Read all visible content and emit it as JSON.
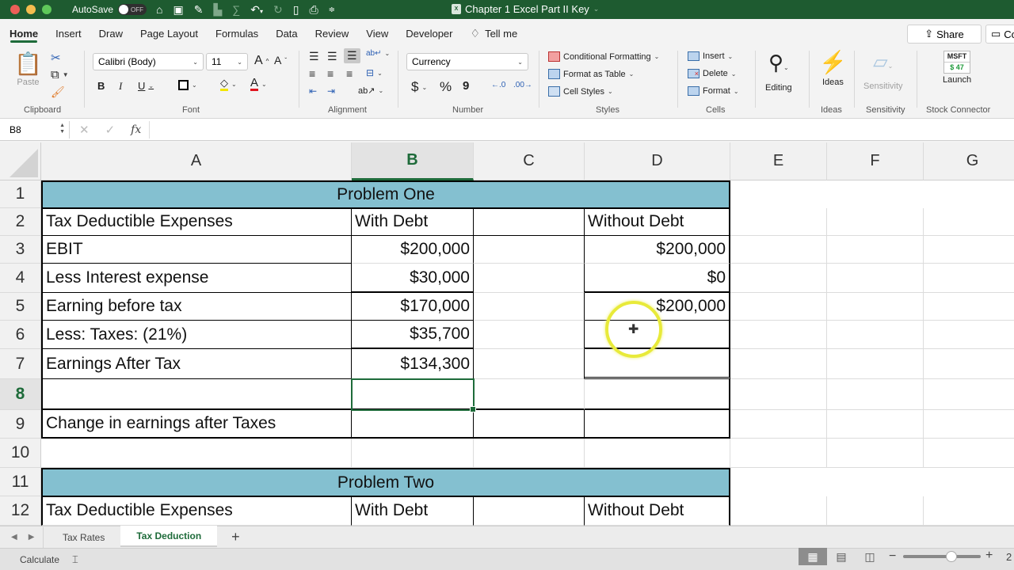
{
  "titlebar": {
    "autosave_label": "AutoSave",
    "autosave_state": "OFF",
    "document_title": "Chapter 1 Excel Part II  Key",
    "traffic_colors": [
      "#ec5f58",
      "#f4bd4f",
      "#5fc85a"
    ],
    "qat_icons": [
      "home-icon",
      "save-icon",
      "edit-icon",
      "format-painter-icon",
      "sum-icon",
      "undo-icon",
      "redo-icon",
      "new-doc-icon",
      "print-icon",
      "customize-icon"
    ]
  },
  "menu": {
    "tabs": [
      "Home",
      "Insert",
      "Draw",
      "Page Layout",
      "Formulas",
      "Data",
      "Review",
      "View",
      "Developer"
    ],
    "active_tab": "Home",
    "tell_me": "Tell me",
    "share": "Share",
    "comments": "Comm"
  },
  "ribbon": {
    "clipboard": {
      "paste": "Paste",
      "label": "Clipboard"
    },
    "font": {
      "name": "Calibri (Body)",
      "size": "11",
      "label": "Font",
      "bold": "B",
      "italic": "I",
      "underline": "U",
      "grow": "A",
      "shrink": "A",
      "highlight_color": "#f3e600",
      "font_color": "#e0141e"
    },
    "alignment": {
      "label": "Alignment"
    },
    "number": {
      "format": "Currency",
      "label": "Number",
      "dollar": "$",
      "percent": "%",
      "comma": "9"
    },
    "styles": {
      "conditional": "Conditional Formatting",
      "format_table": "Format as Table",
      "cell_styles": "Cell Styles",
      "label": "Styles"
    },
    "cells": {
      "insert": "Insert",
      "delete": "Delete",
      "format": "Format",
      "label": "Cells"
    },
    "editing": {
      "label": "Editing"
    },
    "ideas": {
      "button": "Ideas",
      "label": "Ideas"
    },
    "sensitivity": {
      "button": "Sensitivity",
      "label": "Sensitivity"
    },
    "stock": {
      "ticker": "MSFT",
      "price": "$ 47",
      "button": "Launch",
      "label": "Stock Connector"
    }
  },
  "formula_bar": {
    "name_box": "B8",
    "formula": ""
  },
  "columns": [
    "A",
    "B",
    "C",
    "D",
    "E",
    "F",
    "G"
  ],
  "selected_column": "B",
  "selected_row": "8",
  "rows": [
    "1",
    "2",
    "3",
    "4",
    "5",
    "6",
    "7",
    "8",
    "9",
    "10",
    "11",
    "12"
  ],
  "sheet": {
    "problem_one_title": "Problem One",
    "problem_two_title": "Problem Two",
    "cells": {
      "A2": "Tax Deductible Expenses",
      "B2": "With Debt",
      "D2": "Without Debt",
      "A3": "EBIT",
      "B3": "$200,000",
      "D3": "$200,000",
      "A4": "Less Interest expense",
      "B4": "$30,000",
      "D4": "$0",
      "A5": "Earning before tax",
      "B5": "$170,000",
      "D5": "$200,000",
      "A6": "Less: Taxes: (21%)",
      "B6": "$35,700",
      "D6": "",
      "A7": "Earnings After Tax",
      "B7": "$134,300",
      "D7": "",
      "A9": "Change in earnings after Taxes",
      "A12": "Tax Deductible Expenses",
      "B12": "With Debt",
      "D12": "Without Debt"
    },
    "banner_color": "#84c0d0"
  },
  "sheet_tabs": {
    "tabs": [
      "Tax Rates",
      "Tax Deduction"
    ],
    "active": "Tax Deduction",
    "add": "+"
  },
  "status": {
    "calculate": "Calculate",
    "zoom_fraction": 0.62,
    "zoom_label": "2"
  }
}
